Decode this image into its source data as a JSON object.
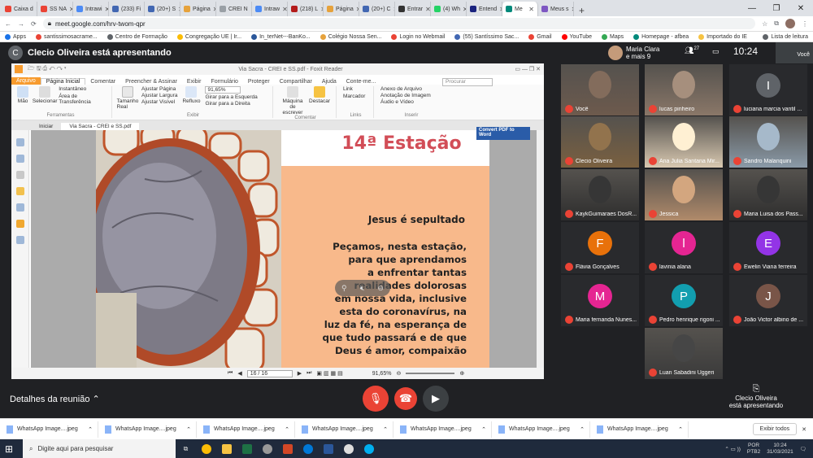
{
  "tabs": [
    {
      "label": "Caixa d",
      "color": "#ea4335"
    },
    {
      "label": "SS NA",
      "color": "#ea4335"
    },
    {
      "label": "Intrawi",
      "color": "#4c8bf5"
    },
    {
      "label": "(233) Fi",
      "color": "#4267b2"
    },
    {
      "label": "(20+) S",
      "color": "#4267b2"
    },
    {
      "label": "Página",
      "color": "#e6a23c"
    },
    {
      "label": "CREI N",
      "color": "#9aa0a6"
    },
    {
      "label": "Intraw",
      "color": "#4c8bf5"
    },
    {
      "label": "(218) L",
      "color": "#b31b1b"
    },
    {
      "label": "Página",
      "color": "#e6a23c"
    },
    {
      "label": "(20+) C",
      "color": "#4267b2"
    },
    {
      "label": "Entrar",
      "color": "#333"
    },
    {
      "label": "(4) Wh",
      "color": "#25d366"
    },
    {
      "label": "Entend",
      "color": "#1a237e"
    },
    {
      "label": "Me",
      "color": "#00897b",
      "active": true
    },
    {
      "label": "Meus s",
      "color": "#7e57c2"
    }
  ],
  "address": {
    "url": "meet.google.com/hrv-twom-qpr"
  },
  "bookmarks": [
    "Apps",
    "santissimosacrame...",
    "Centro de Formação",
    "Congregação UE | Ir...",
    "In_terNet---BanKo...",
    "Colégio Nossa Sen...",
    "Login no Webmail",
    "(55) Santíssimo Sac...",
    "Gmail",
    "YouTube",
    "Maps",
    "Homepage - afbea",
    "Importado do IE",
    "Lista de leitura"
  ],
  "meet": {
    "presenter_initial": "C",
    "presenting_title": "Clecio Oliveira está apresentando",
    "top_name": "Maria Clara",
    "top_sub": "e mais 9",
    "participant_count": "27",
    "time": "10:24",
    "you_label": "Você"
  },
  "pdf": {
    "window_title": "Via Sacra - CREI e SS.pdf - Foxit Reader",
    "menu": [
      "Arquivo",
      "Página Inicial",
      "Comentar",
      "Preencher & Assinar",
      "Exibir",
      "Formulário",
      "Proteger",
      "Compartilhar",
      "Ajuda",
      "Conte-me..."
    ],
    "search_placeholder": "Procurar",
    "ribbon": {
      "mao": "Mão",
      "selecionar": "Selecionar",
      "instantaneo": "Instantâneo",
      "area": "Área de Transferência",
      "grp_ferramentas": "Ferramentas",
      "tamanho": "Tamanho Real",
      "ajustar_pagina": "Ajustar Página",
      "ajustar_largura": "Ajustar Largura",
      "ajustar_visivel": "Ajustar Visível",
      "refluxo": "Refluxo",
      "zoom": "91,65%",
      "girar_esq": "Girar para a Esquerda",
      "girar_dir": "Girar para a Direita",
      "grp_exibir": "Exibir",
      "maquina": "Máquina de escrever",
      "destacar": "Destacar",
      "grp_comentar": "Comentar",
      "link": "Link",
      "marcador": "Marcador",
      "grp_links": "Links",
      "anexo": "Anexo de Arquivo",
      "anotacao": "Anotação de Imagem",
      "audio": "Áudio e Vídeo",
      "grp_inserir": "Inserir"
    },
    "doc_tabs": [
      "Iniciar",
      "Via Sacra - CREI e SS.pdf"
    ],
    "convert": "Convert PDF to Word",
    "page_title": "14ª Estação",
    "subtitle": "Jesus é sepultado",
    "body_lines": [
      "Peçamos, nesta estação,",
      "para que aprendamos",
      "a enfrentar tantas",
      "realidades dolorosas",
      "em nossa vida, inclusive",
      "esta do coronavírus, na",
      "luz da fé, na esperança de",
      "que tudo passará e de que",
      "Deus é amor, compaixão"
    ],
    "page_indicator": "16 / 16",
    "status_zoom": "91,65%"
  },
  "participants": [
    {
      "name": "Você",
      "type": "photo",
      "color": "#6d5a4d"
    },
    {
      "name": "lucas pinheiro",
      "type": "photo",
      "color": "#8a7768"
    },
    {
      "name": "luciana marcia vantil ...",
      "type": "avatar",
      "initial": "I",
      "color": "#5f6368"
    },
    {
      "name": "Clecio Oliveira",
      "type": "photo",
      "color": "#7a6040"
    },
    {
      "name": "Ana Julia Santana Mir...",
      "type": "photo",
      "color": "#d8c8b0"
    },
    {
      "name": "Sandro Malanquini",
      "type": "photo",
      "color": "#8a9aa8"
    },
    {
      "name": "KaykGuimaraes DosR...",
      "type": "photo",
      "color": "#2d2d2d"
    },
    {
      "name": "Jessica",
      "type": "photo",
      "color": "#b08a6a"
    },
    {
      "name": "Maria Luisa dos Pass...",
      "type": "photo",
      "color": "#2d2d2d"
    },
    {
      "name": "Flávia Gonçalves",
      "type": "avatar",
      "initial": "F",
      "color": "#e8710a"
    },
    {
      "name": "lavinia alana",
      "type": "avatar",
      "initial": "l",
      "color": "#e52592"
    },
    {
      "name": "Ewelin Viana ferreira",
      "type": "avatar",
      "initial": "E",
      "color": "#9334e6"
    },
    {
      "name": "Maria fernanda Nunes...",
      "type": "avatar",
      "initial": "M",
      "color": "#e52592"
    },
    {
      "name": "Pedro henrique rigoni ...",
      "type": "avatar",
      "initial": "P",
      "color": "#129eaf"
    },
    {
      "name": "João Victor albino de ...",
      "type": "avatar",
      "initial": "J",
      "color": "#795548"
    },
    {
      "name": "Luan Sabadini Uggeri",
      "type": "photo",
      "color": "#3a3a3a"
    }
  ],
  "bottom": {
    "details": "Detalhes da reunião",
    "presenter_name": "Clecio Oliveira",
    "presenter_status": "está apresentando"
  },
  "downloads": {
    "items": [
      "WhatsApp Image....jpeg",
      "WhatsApp Image....jpeg",
      "WhatsApp Image....jpeg",
      "WhatsApp Image....jpeg",
      "WhatsApp Image....jpeg",
      "WhatsApp Image....jpeg",
      "WhatsApp Image....jpeg"
    ],
    "show_all": "Exibir todos"
  },
  "taskbar": {
    "search_placeholder": "Digite aqui para pesquisar",
    "lang": "POR",
    "layout": "PTB2",
    "clock_time": "10:24",
    "clock_date": "31/03/2021"
  }
}
